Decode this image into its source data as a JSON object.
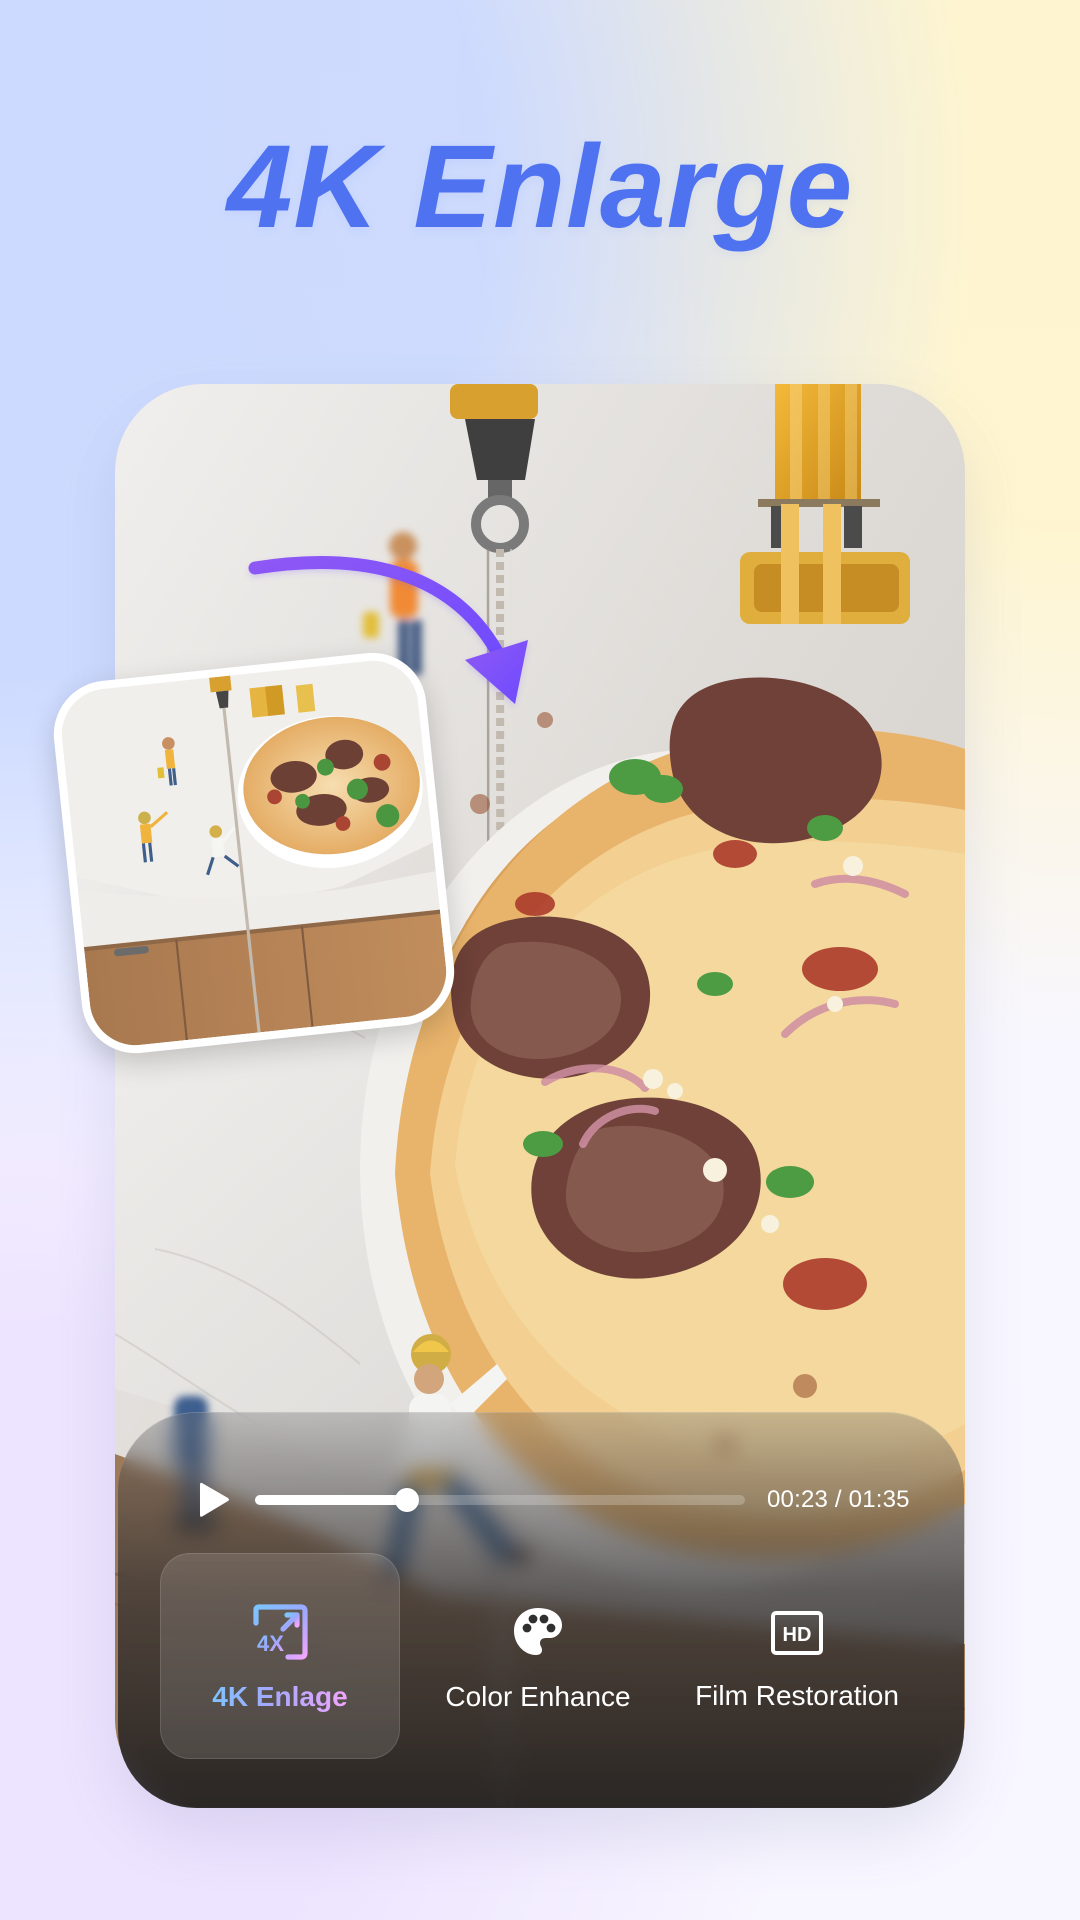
{
  "page": {
    "title": "4K Enlarge"
  },
  "player": {
    "time_display": "00:23 / 01:35",
    "progress": 0.31
  },
  "features": [
    {
      "label": "4K Enlage",
      "icon": "4x-enlarge-icon",
      "selected": true
    },
    {
      "label": "Color Enhance",
      "icon": "palette-icon",
      "selected": false
    },
    {
      "label": "Film Restoration",
      "icon": "hd-icon",
      "selected": false
    }
  ],
  "icons": {
    "badge_text_4x": "4X",
    "badge_text_hd": "HD"
  },
  "colors": {
    "headline": "#4F72F1",
    "arrow_start": "#8C5CF4",
    "arrow_end": "#6B4BFF",
    "panel_text": "#FFFFFF"
  }
}
